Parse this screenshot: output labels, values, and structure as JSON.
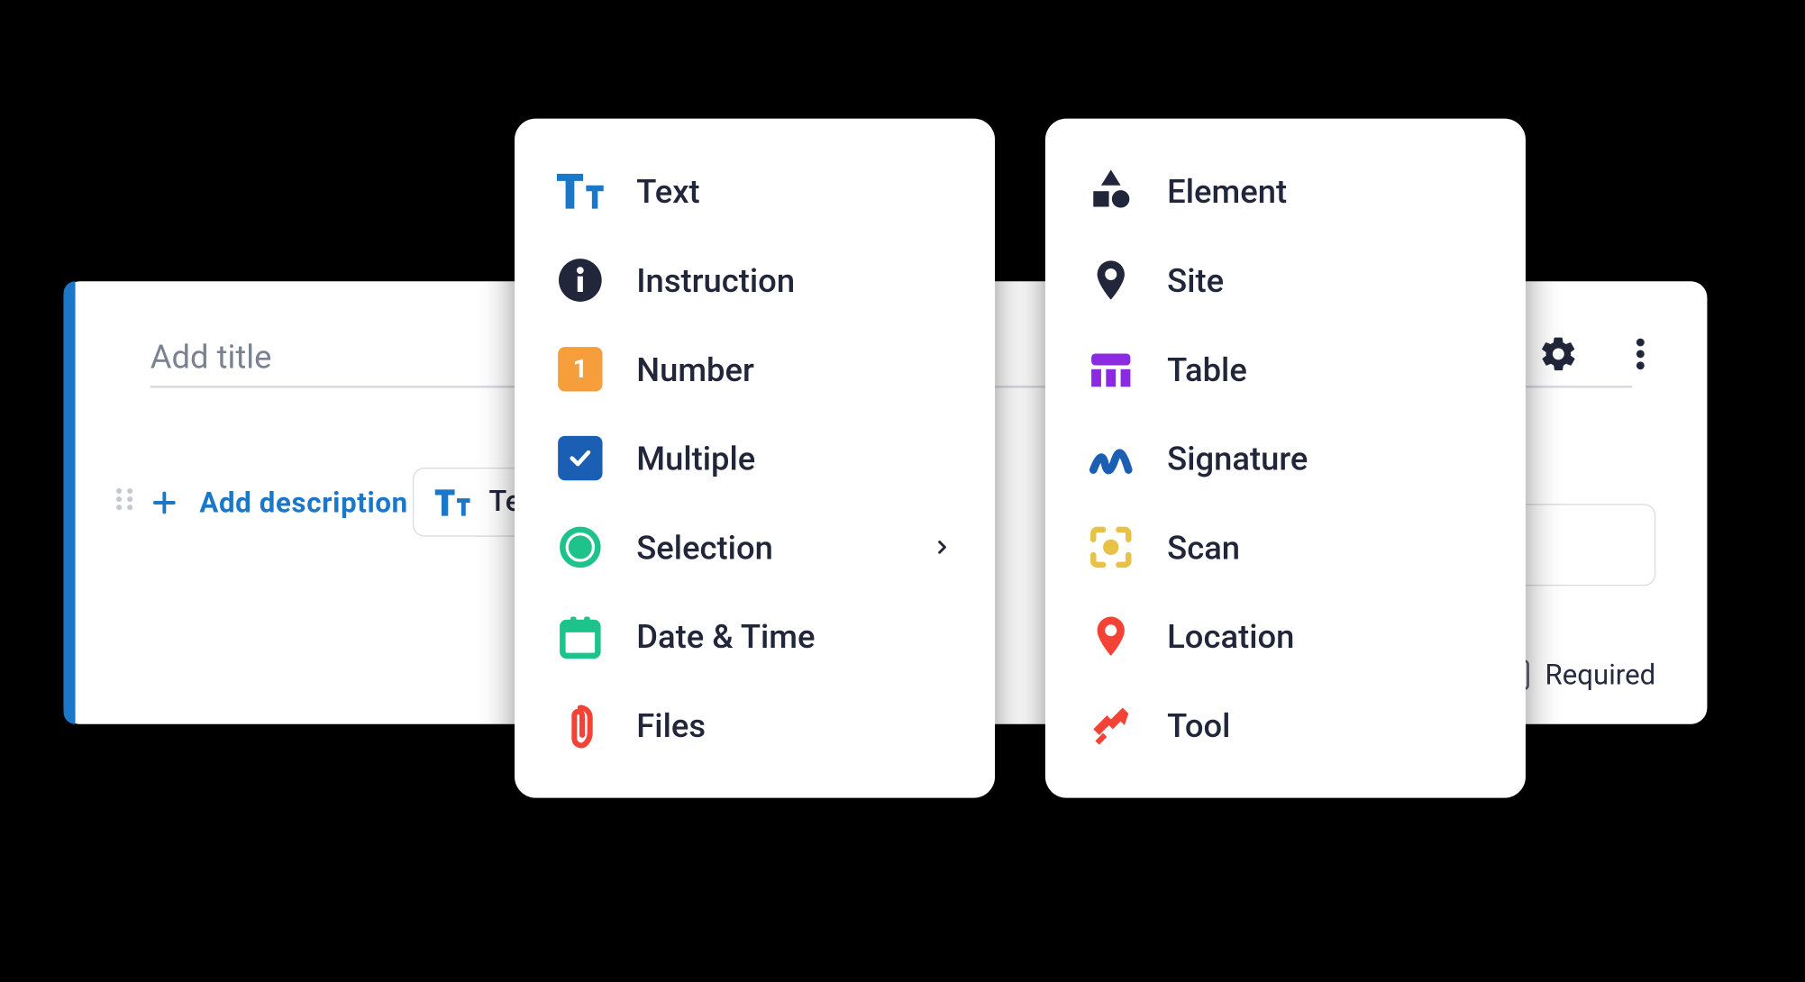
{
  "editor": {
    "title_placeholder": "Add title",
    "add_description": "Add description",
    "selected_type": "Text",
    "required_label": "Required"
  },
  "menus": {
    "left": {
      "items": [
        {
          "label": "Text"
        },
        {
          "label": "Instruction"
        },
        {
          "label": "Number"
        },
        {
          "label": "Multiple"
        },
        {
          "label": "Selection",
          "has_submenu": true
        },
        {
          "label": "Date & Time"
        },
        {
          "label": "Files"
        }
      ]
    },
    "right": {
      "items": [
        {
          "label": "Element"
        },
        {
          "label": "Site"
        },
        {
          "label": "Table"
        },
        {
          "label": "Signature"
        },
        {
          "label": "Scan"
        },
        {
          "label": "Location"
        },
        {
          "label": "Tool"
        }
      ]
    }
  }
}
